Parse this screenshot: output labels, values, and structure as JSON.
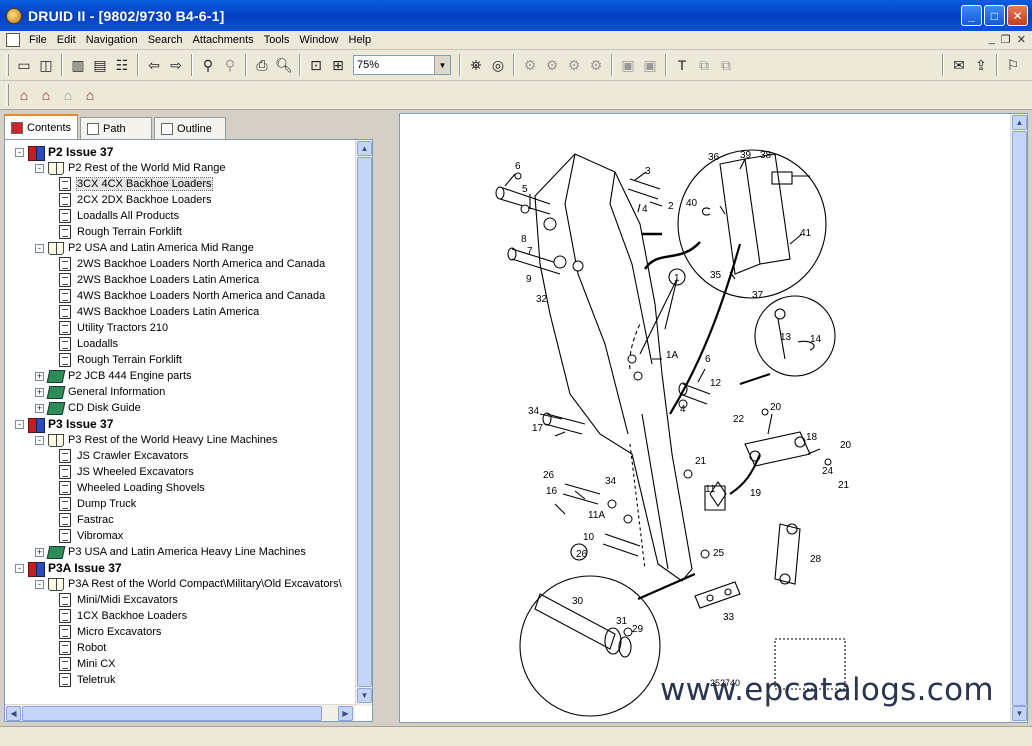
{
  "window": {
    "title": "DRUID II - [9802/9730  B4-6-1]"
  },
  "menu": [
    "File",
    "Edit",
    "Navigation",
    "Search",
    "Attachments",
    "Tools",
    "Window",
    "Help"
  ],
  "toolbar": {
    "zoom": "75%"
  },
  "tabs": [
    "Contents",
    "Path",
    "Outline"
  ],
  "tree": [
    {
      "label": "P2 Issue 37",
      "level": 0,
      "icon": "books-icon",
      "bold": true,
      "expander": "-"
    },
    {
      "label": "P2 Rest of the World Mid Range",
      "level": 1,
      "icon": "open-book-icon",
      "expander": "-"
    },
    {
      "label": "3CX 4CX Backhoe Loaders",
      "level": 2,
      "icon": "page-icon",
      "selected": true
    },
    {
      "label": "2CX 2DX Backhoe Loaders",
      "level": 2,
      "icon": "page-icon"
    },
    {
      "label": "Loadalls All Products",
      "level": 2,
      "icon": "page-icon"
    },
    {
      "label": "Rough Terrain Forklift",
      "level": 2,
      "icon": "page-icon"
    },
    {
      "label": "P2 USA and Latin America Mid Range",
      "level": 1,
      "icon": "open-book-icon",
      "expander": "-"
    },
    {
      "label": "2WS Backhoe Loaders North America and Canada",
      "level": 2,
      "icon": "page-icon"
    },
    {
      "label": "2WS Backhoe Loaders Latin America",
      "level": 2,
      "icon": "page-icon"
    },
    {
      "label": "4WS Backhoe Loaders North America and Canada",
      "level": 2,
      "icon": "page-icon"
    },
    {
      "label": "4WS Backhoe Loaders Latin America",
      "level": 2,
      "icon": "page-icon"
    },
    {
      "label": "Utility Tractors 210",
      "level": 2,
      "icon": "page-icon"
    },
    {
      "label": "Loadalls",
      "level": 2,
      "icon": "page-icon"
    },
    {
      "label": "Rough Terrain Forklift",
      "level": 2,
      "icon": "page-icon"
    },
    {
      "label": "P2 JCB 444 Engine parts",
      "level": 1,
      "icon": "closed-book-icon",
      "expander": "+"
    },
    {
      "label": "General Information",
      "level": 1,
      "icon": "closed-book-icon",
      "expander": "+"
    },
    {
      "label": "CD Disk Guide",
      "level": 1,
      "icon": "closed-book-icon",
      "expander": "+"
    },
    {
      "label": "P3 Issue 37",
      "level": 0,
      "icon": "books-icon",
      "bold": true,
      "expander": "-"
    },
    {
      "label": "P3 Rest of the World Heavy Line Machines",
      "level": 1,
      "icon": "open-book-icon",
      "expander": "-"
    },
    {
      "label": "JS Crawler Excavators",
      "level": 2,
      "icon": "page-icon"
    },
    {
      "label": "JS Wheeled Excavators",
      "level": 2,
      "icon": "page-icon"
    },
    {
      "label": "Wheeled Loading Shovels",
      "level": 2,
      "icon": "page-icon"
    },
    {
      "label": "Dump Truck",
      "level": 2,
      "icon": "page-icon"
    },
    {
      "label": "Fastrac",
      "level": 2,
      "icon": "page-icon"
    },
    {
      "label": "Vibromax",
      "level": 2,
      "icon": "page-icon"
    },
    {
      "label": "P3 USA and Latin America Heavy Line Machines",
      "level": 1,
      "icon": "closed-book-icon",
      "expander": "+"
    },
    {
      "label": "P3A Issue 37",
      "level": 0,
      "icon": "books-icon",
      "bold": true,
      "expander": "-"
    },
    {
      "label": "P3A Rest of the World Compact\\Military\\Old Excavators\\",
      "level": 1,
      "icon": "open-book-icon",
      "expander": "-"
    },
    {
      "label": "Mini/Midi Excavators",
      "level": 2,
      "icon": "page-icon"
    },
    {
      "label": "1CX Backhoe Loaders",
      "level": 2,
      "icon": "page-icon"
    },
    {
      "label": "Micro Excavators",
      "level": 2,
      "icon": "page-icon"
    },
    {
      "label": "Robot",
      "level": 2,
      "icon": "page-icon"
    },
    {
      "label": "Mini CX",
      "level": 2,
      "icon": "page-icon"
    },
    {
      "label": "Teletruk",
      "level": 2,
      "icon": "page-icon"
    }
  ],
  "diagram": {
    "labels": [
      "6",
      "3",
      "5",
      "2",
      "4",
      "36",
      "39",
      "38",
      "40",
      "41",
      "35",
      "37",
      "8",
      "7",
      "9",
      "32",
      "1",
      "1A",
      "6",
      "12",
      "4",
      "13",
      "14",
      "34",
      "17",
      "22",
      "20",
      "18",
      "20",
      "24",
      "21",
      "19",
      "26",
      "34",
      "21",
      "16",
      "11",
      "11A",
      "10",
      "26",
      "25",
      "28",
      "30",
      "31",
      "29",
      "33"
    ],
    "drawing_number": "252740"
  },
  "watermark": "www.epcatalogs.com"
}
